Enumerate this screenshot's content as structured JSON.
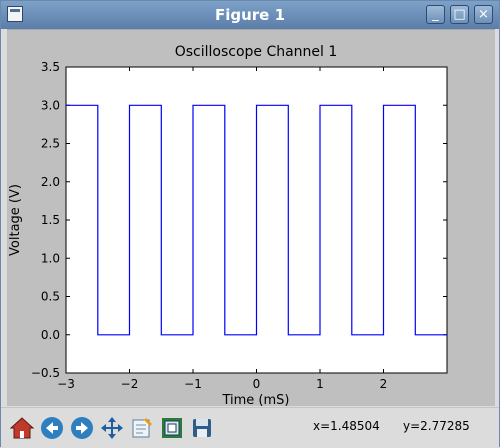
{
  "window": {
    "title": "Figure 1"
  },
  "toolbar": {
    "buttons": [
      {
        "icon": "home-icon"
      },
      {
        "icon": "back-arrow-icon"
      },
      {
        "icon": "forward-arrow-icon"
      },
      {
        "icon": "pan-icon"
      },
      {
        "icon": "zoom-rect-icon"
      },
      {
        "icon": "subplots-icon"
      },
      {
        "icon": "save-icon"
      }
    ],
    "x_readout": "x=1.48504",
    "y_readout": "y=2.77285"
  },
  "chart_data": {
    "type": "line",
    "title": "Oscilloscope Channel 1",
    "xlabel": "Time (mS)",
    "ylabel": "Voltage (V)",
    "xlim": [
      -3,
      3
    ],
    "ylim": [
      -0.5,
      3.5
    ],
    "xticks": [
      "−3",
      "−2",
      "−1",
      "0",
      "1",
      "2"
    ],
    "yticks": [
      "−0.5",
      "0.0",
      "0.5",
      "1.0",
      "1.5",
      "2.0",
      "2.5",
      "3.0",
      "3.5"
    ],
    "grid": false,
    "series": [
      {
        "color": "#0000ff",
        "x": [
          -3.0,
          -2.5,
          -2.5,
          -2.0,
          -2.0,
          -1.5,
          -1.5,
          -1.0,
          -1.0,
          -0.5,
          -0.5,
          0.0,
          0.0,
          0.5,
          0.5,
          1.0,
          1.0,
          1.5,
          1.5,
          2.0,
          2.0,
          2.5,
          2.5,
          3.0
        ],
        "y": [
          3.0,
          3.0,
          0.0,
          0.0,
          3.0,
          3.0,
          0.0,
          0.0,
          3.0,
          3.0,
          0.0,
          0.0,
          3.0,
          3.0,
          0.0,
          0.0,
          3.0,
          3.0,
          0.0,
          0.0,
          3.0,
          3.0,
          0.0,
          0.0
        ]
      }
    ]
  }
}
